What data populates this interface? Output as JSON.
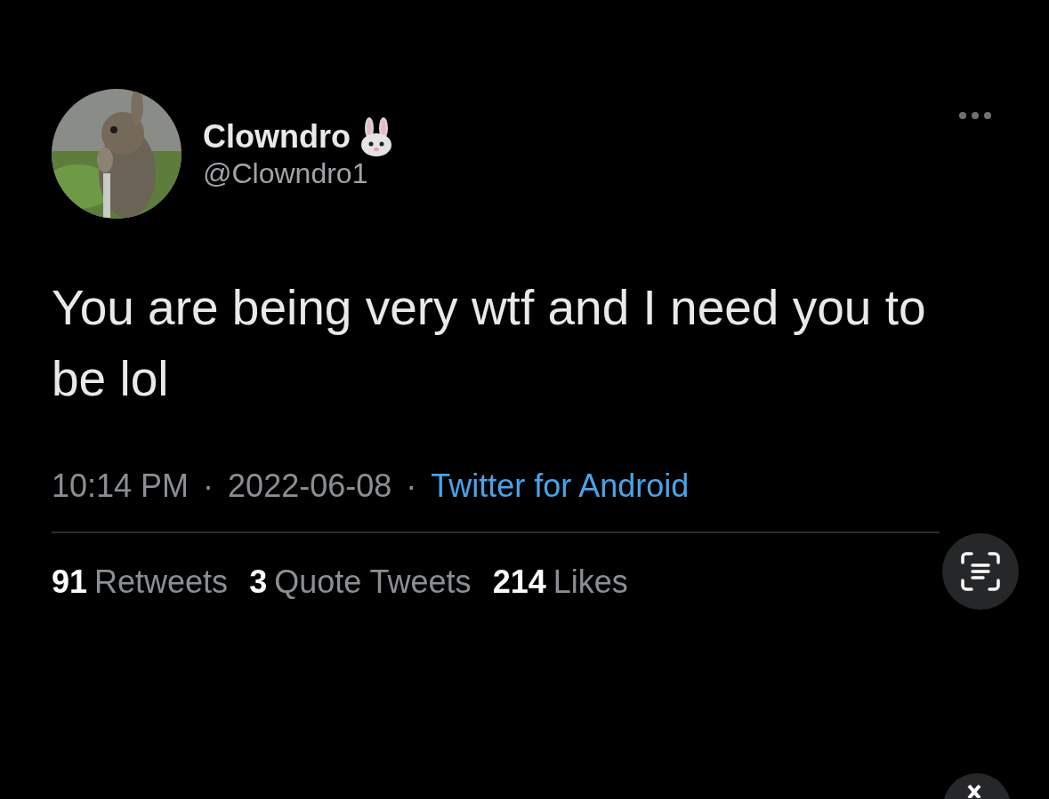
{
  "author": {
    "name": "Clowndro",
    "handle": "@Clowndro1"
  },
  "text": "You are being very wtf and I need you to be lol",
  "meta": {
    "time": "10:14 PM",
    "separator": "·",
    "date": "2022-06-08",
    "source": "Twitter for Android"
  },
  "stats": [
    {
      "count": "91",
      "label": "Retweets"
    },
    {
      "count": "3",
      "label": "Quote Tweets"
    },
    {
      "count": "214",
      "label": "Likes"
    }
  ]
}
